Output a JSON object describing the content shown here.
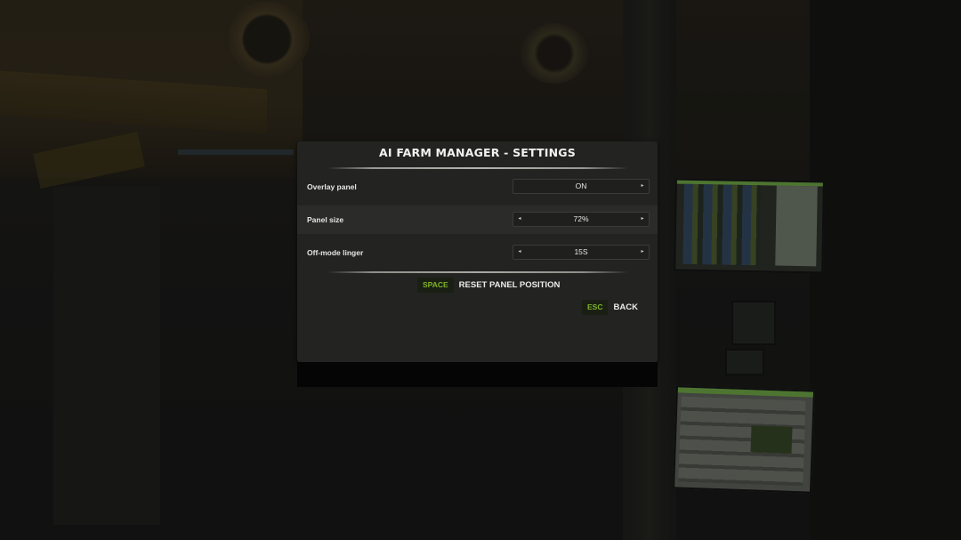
{
  "dialog": {
    "title": "AI FARM MANAGER - SETTINGS",
    "settings": [
      {
        "label": "Overlay panel",
        "value": "ON",
        "has_left_arrow": false,
        "has_right_arrow": true
      },
      {
        "label": "Panel size",
        "value": "72%",
        "has_left_arrow": true,
        "has_right_arrow": true
      },
      {
        "label": "Off-mode linger",
        "value": "15S",
        "has_left_arrow": true,
        "has_right_arrow": true
      }
    ],
    "actions": [
      {
        "key": "SPACE",
        "label": "RESET PANEL POSITION"
      },
      {
        "key": "ESC",
        "label": "BACK"
      }
    ]
  },
  "arrows": {
    "left": "◂",
    "right": "▸"
  },
  "colors": {
    "key_accent": "#7fb32a",
    "dialog_bg": "#232322",
    "row_alt_bg": "#2b2b2a",
    "selector_bg": "#1f1f1e"
  }
}
